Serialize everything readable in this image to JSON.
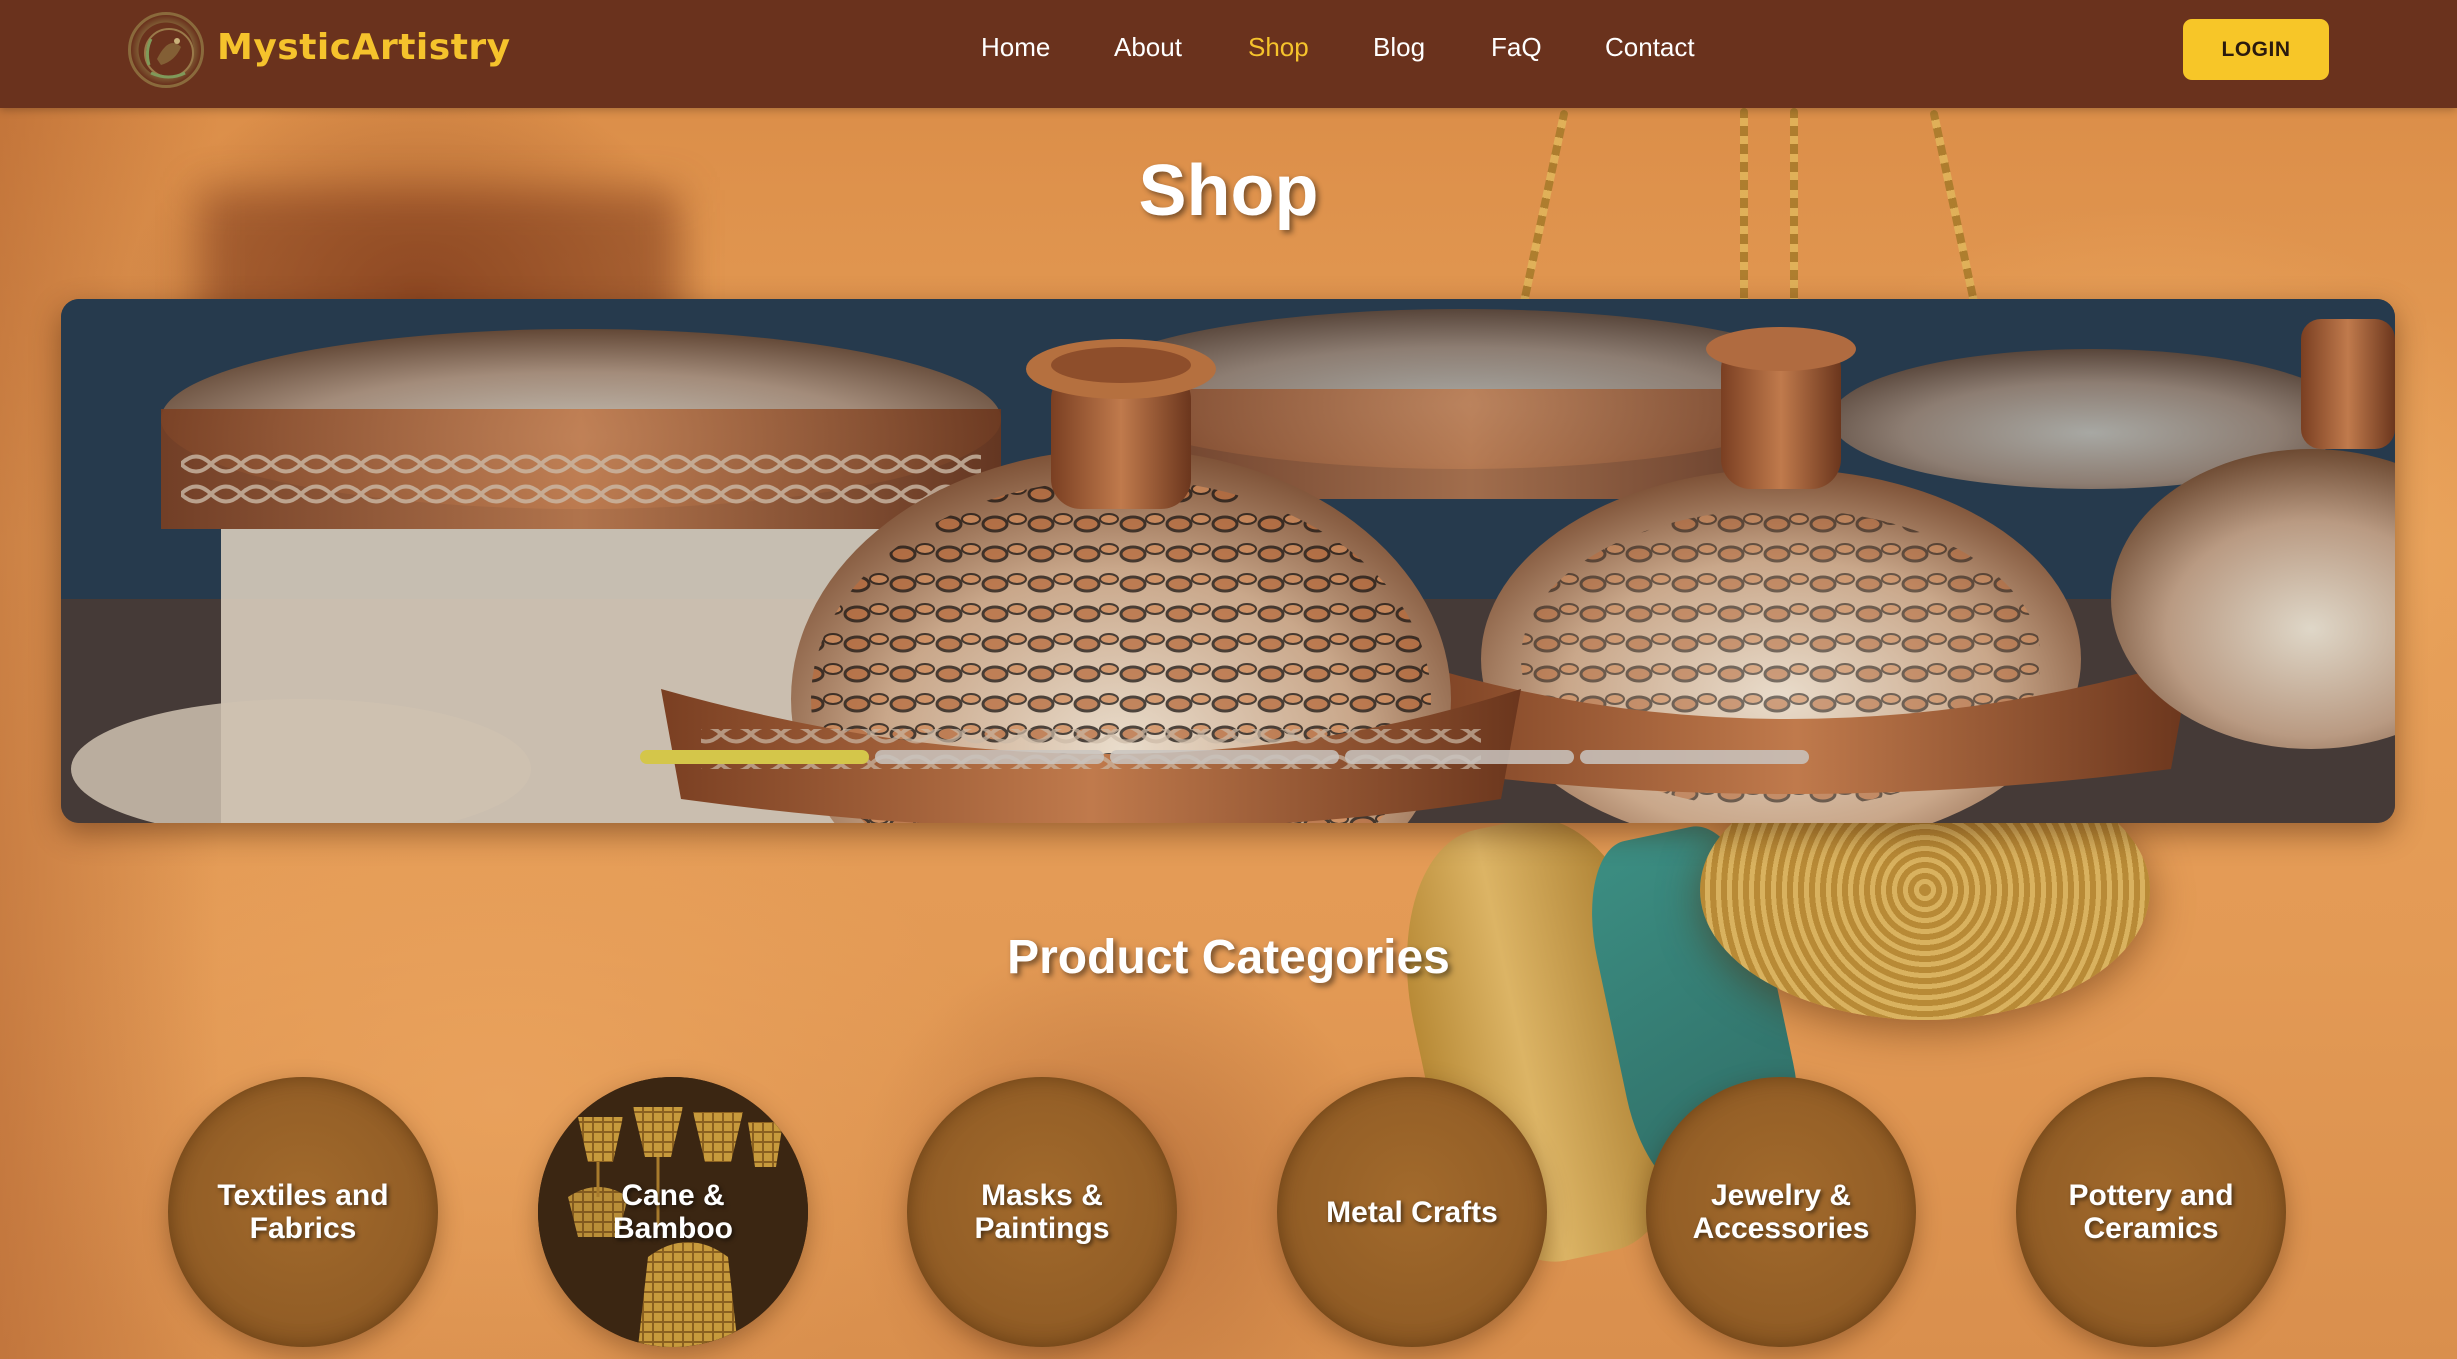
{
  "header": {
    "brand": "MysticArtistry",
    "nav": [
      {
        "label": "Home",
        "active": false
      },
      {
        "label": "About",
        "active": false
      },
      {
        "label": "Shop",
        "active": true
      },
      {
        "label": "Blog",
        "active": false
      },
      {
        "label": "FaQ",
        "active": false
      },
      {
        "label": "Contact",
        "active": false
      }
    ],
    "login_label": "LOGIN"
  },
  "page_title": "Shop",
  "carousel": {
    "slide_count": 5,
    "active_slide": 1,
    "active_progress": 1.0
  },
  "categories_section": {
    "title": "Product Categories",
    "items": [
      {
        "label": "Textiles and Fabrics"
      },
      {
        "label": "Cane & Bamboo"
      },
      {
        "label": "Masks & Paintings"
      },
      {
        "label": "Metal Crafts"
      },
      {
        "label": "Jewelry & Accessories"
      },
      {
        "label": "Pottery and Ceramics"
      }
    ]
  },
  "colors": {
    "header_bg": "#6a321d",
    "accent": "#f5c32c",
    "progress_active": "#d4c64a",
    "progress_inactive": "#c9c4c0"
  }
}
